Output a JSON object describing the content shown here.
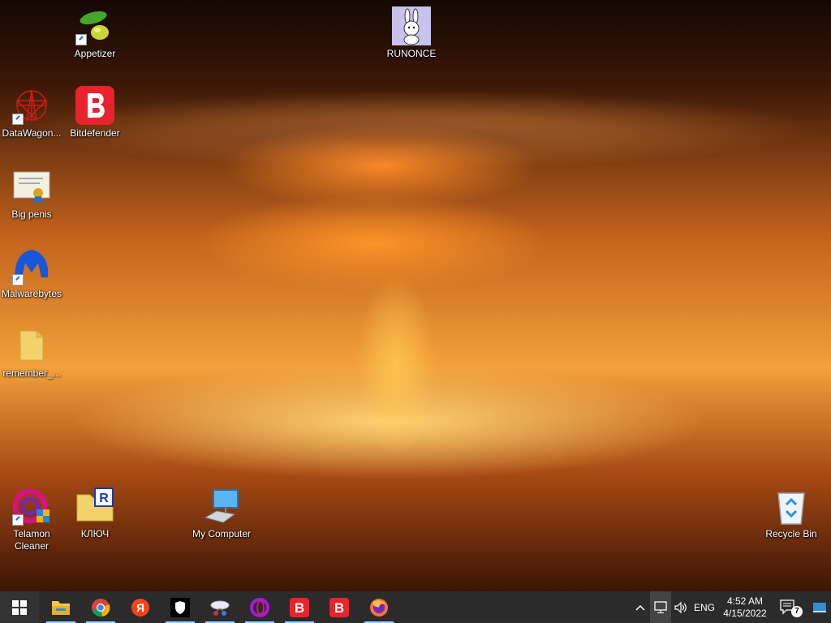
{
  "desktop": {
    "icons": [
      {
        "label": "Appetizer"
      },
      {
        "label": "RUNONCE"
      },
      {
        "label": "DataWagon..."
      },
      {
        "label": "Bitdefender"
      },
      {
        "label": "Big penis"
      },
      {
        "label": "Malwarebytes"
      },
      {
        "label": "remember_..."
      },
      {
        "label": "Telamon\nCleaner"
      },
      {
        "label": "КЛЮЧ"
      },
      {
        "label": "My Computer"
      },
      {
        "label": "Recycle Bin"
      }
    ]
  },
  "taskbar": {
    "start_icon": "windows-logo-icon",
    "apps": [
      {
        "icon": "file-explorer-icon"
      },
      {
        "icon": "chrome-icon"
      },
      {
        "icon": "yandex-icon"
      },
      {
        "icon": "shield-app-icon"
      },
      {
        "icon": "network-app-icon"
      },
      {
        "icon": "opera-icon"
      },
      {
        "icon": "bitdefender-icon"
      },
      {
        "icon": "bitdefender-icon"
      },
      {
        "icon": "firefox-icon"
      }
    ],
    "tray": {
      "language": "ENG",
      "time": "4:52 AM",
      "date": "4/15/2022",
      "notification_count": "7"
    }
  },
  "colors": {
    "taskbar": "#2b2b2b",
    "bitdefender_red": "#e8232d",
    "folder_yellow": "#f2d36b"
  }
}
